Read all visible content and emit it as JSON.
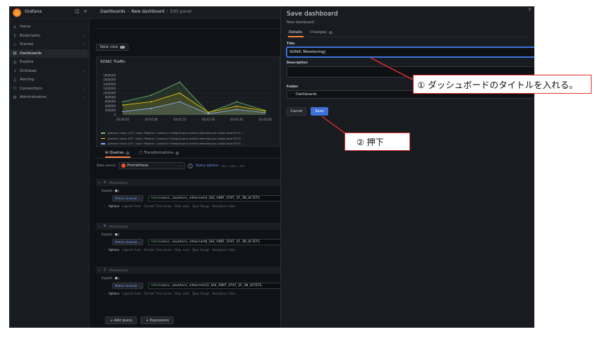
{
  "app": {
    "brand": "Grafana"
  },
  "breadcrumbs": [
    "Dashboards",
    "New dashboard",
    "Edit panel"
  ],
  "sidebar": {
    "items": [
      {
        "label": "Home",
        "icon": "home-icon",
        "expandable": false,
        "active": false
      },
      {
        "label": "Bookmarks",
        "icon": "bookmark-icon",
        "expandable": true,
        "active": false
      },
      {
        "label": "Starred",
        "icon": "star-icon",
        "expandable": true,
        "active": false
      },
      {
        "label": "Dashboards",
        "icon": "grid-icon",
        "expandable": true,
        "active": true
      },
      {
        "label": "Explore",
        "icon": "compass-icon",
        "expandable": false,
        "active": false
      },
      {
        "label": "Drilldown",
        "icon": "drilldown-icon",
        "expandable": true,
        "active": false
      },
      {
        "label": "Alerting",
        "icon": "bell-icon",
        "expandable": true,
        "active": false
      },
      {
        "label": "Connections",
        "icon": "plug-icon",
        "expandable": true,
        "active": false
      },
      {
        "label": "Administration",
        "icon": "gear-icon",
        "expandable": true,
        "active": false
      }
    ]
  },
  "editor": {
    "table_view_label": "Table view",
    "panel_title": "SONiC Traffic",
    "legend": [
      {
        "text": "{device=\"sonic-107\", host=\"Monitor\", instance=\"telegraf-sonic-metrics.telemetry.svc.cluster.local:9273\", ...",
        "color": "#73bf69"
      },
      {
        "text": "{device=\"sonic-107\", host=\"Monitor\", instance=\"telegraf-sonic-metrics.telemetry.svc.cluster.local:9273\", ...",
        "color": "#f2cc0c"
      },
      {
        "text": "{device=\"sonic-107\", host=\"Monitor\", instance=\"telegraf-sonic-metrics.telemetry.svc.cluster.local:9273\", ...",
        "color": "#8ab8ff"
      }
    ],
    "tabs": {
      "queries_label": "Queries",
      "queries_count": "3",
      "transformations_label": "Transformations",
      "transformations_count": "0"
    },
    "datasource_label": "Data source",
    "datasource_value": "Prometheus",
    "query_options_label": "Query options",
    "query_options_meta": "MD = auto = 500",
    "queries": [
      {
        "ref": "A",
        "datasource": "(Prometheus)",
        "explain": "Explain",
        "metrics_browser": "Metrics browser",
        "expr_fn": "rate",
        "expr_rest": "(sonic_counters_ethernet4_SAI_PORT_STAT_IF_IN_OCTETS",
        "options_label": "Options",
        "legend": "Legend: Auto",
        "format": "Format: Time series",
        "step": "Step: auto",
        "type": "Type: Range",
        "exemplars": "Exemplars: false"
      },
      {
        "ref": "B",
        "datasource": "(Prometheus)",
        "explain": "Explain",
        "metrics_browser": "Metrics browser",
        "expr_fn": "rate",
        "expr_rest": "(sonic_counters_ethernet8_SAI_PORT_STAT_IF_IN_OCTETS",
        "options_label": "Options",
        "legend": "Legend: Auto",
        "format": "Format: Time series",
        "step": "Step: auto",
        "type": "Type: Range",
        "exemplars": "Exemplars: false"
      },
      {
        "ref": "C",
        "datasource": "(Prometheus)",
        "explain": "Explain",
        "metrics_browser": "Metrics browser",
        "expr_fn": "rate",
        "expr_rest": "(sonic_counters_ethernet12_SAI_PORT_STAT_IF_IN_OCTETS",
        "options_label": "Options",
        "legend": "Legend: Auto",
        "format": "Format: Time series",
        "step": "Step: auto",
        "type": "Type: Range",
        "exemplars": "Exemplars: false"
      }
    ],
    "add_query_label": "+ Add query",
    "expression_label": "+ Expression"
  },
  "chart_data": {
    "type": "area",
    "title": "SONiC Traffic",
    "x": [
      "03:40:45",
      "03:41:00",
      "03:41:15",
      "03:41:30",
      "03:41:45",
      "03:42:00"
    ],
    "ylim": [
      0,
      2000000
    ],
    "yticks": [
      "1800000",
      "1600000",
      "1400000",
      "1200000",
      "1000000",
      "800000",
      "600000",
      "400000",
      "200000",
      "0"
    ],
    "series": [
      {
        "values": [
          600000,
          900000,
          1500000,
          100000,
          600000,
          200000
        ],
        "color": "#73bf69"
      },
      {
        "values": [
          450000,
          600000,
          1000000,
          120000,
          400000,
          180000
        ],
        "color": "#f2cc0c"
      },
      {
        "values": [
          150000,
          300000,
          600000,
          50000,
          250000,
          100000
        ],
        "color": "#8ab8ff"
      }
    ]
  },
  "save_drawer": {
    "title": "Save dashboard",
    "subtitle": "New dashboard",
    "tabs": {
      "details_label": "Details",
      "changes_label": "Changes",
      "changes_count": "9"
    },
    "title_label": "Title",
    "title_value": "SONiC Monitoring",
    "description_label": "Description",
    "description_value": "",
    "folder_label": "Folder",
    "folder_value": "Dashboards",
    "cancel_label": "Cancel",
    "save_label": "Save",
    "close_glyph": "×"
  },
  "annotations": {
    "callout_1": "① ダッシュボードのタイトルを入れる。",
    "callout_2": "② 押下",
    "color": "#e5312e"
  }
}
